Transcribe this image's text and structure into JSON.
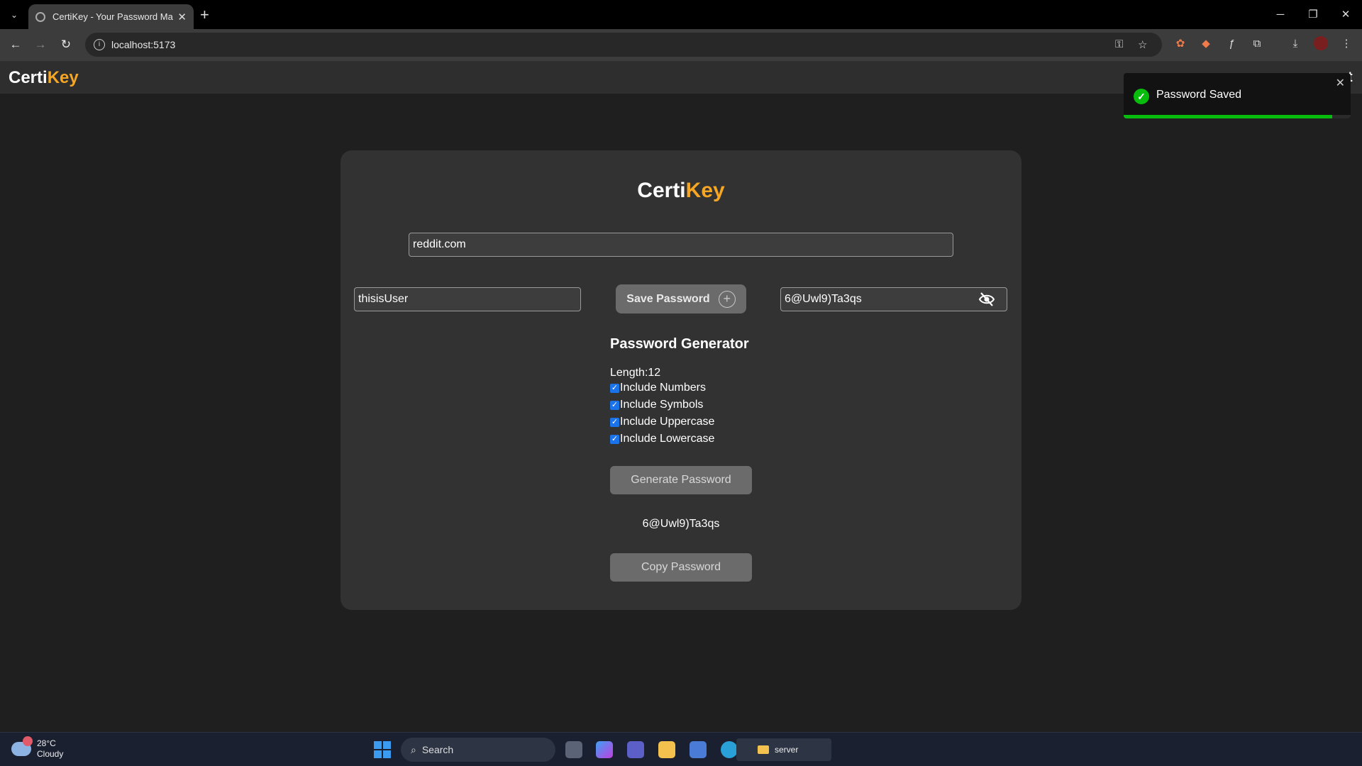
{
  "browser": {
    "tab_title": "CertiKey - Your Password Mana",
    "url": "localhost:5173",
    "new_tab_label": "+",
    "window_controls": {
      "minimize": "─",
      "restore": "❐",
      "close": "✕"
    }
  },
  "app": {
    "brand_part1": "Certi",
    "brand_part2": "Key",
    "brand_color": "#f5a623"
  },
  "form": {
    "site_value": "reddit.com",
    "username_value": "thisisUser",
    "password_value": "6@Uwl9)Ta3qs",
    "save_button_label": "Save Password"
  },
  "generator": {
    "title": "Password Generator",
    "length_label": "Length:12",
    "options": [
      {
        "label": "Include Numbers",
        "checked": true
      },
      {
        "label": "Include Symbols",
        "checked": true
      },
      {
        "label": "Include Uppercase",
        "checked": true
      },
      {
        "label": "Include Lowercase",
        "checked": true
      }
    ],
    "generate_button_label": "Generate Password",
    "generated_password": "6@Uwl9)Ta3qs",
    "copy_button_label": "Copy Password"
  },
  "toast": {
    "message": "Password Saved",
    "progress": 0.92,
    "color": "#07bc0c"
  },
  "nav_edge_char": "t",
  "taskbar": {
    "temperature": "28°C",
    "condition": "Cloudy",
    "search_label": "Search",
    "folder_label": "server"
  }
}
